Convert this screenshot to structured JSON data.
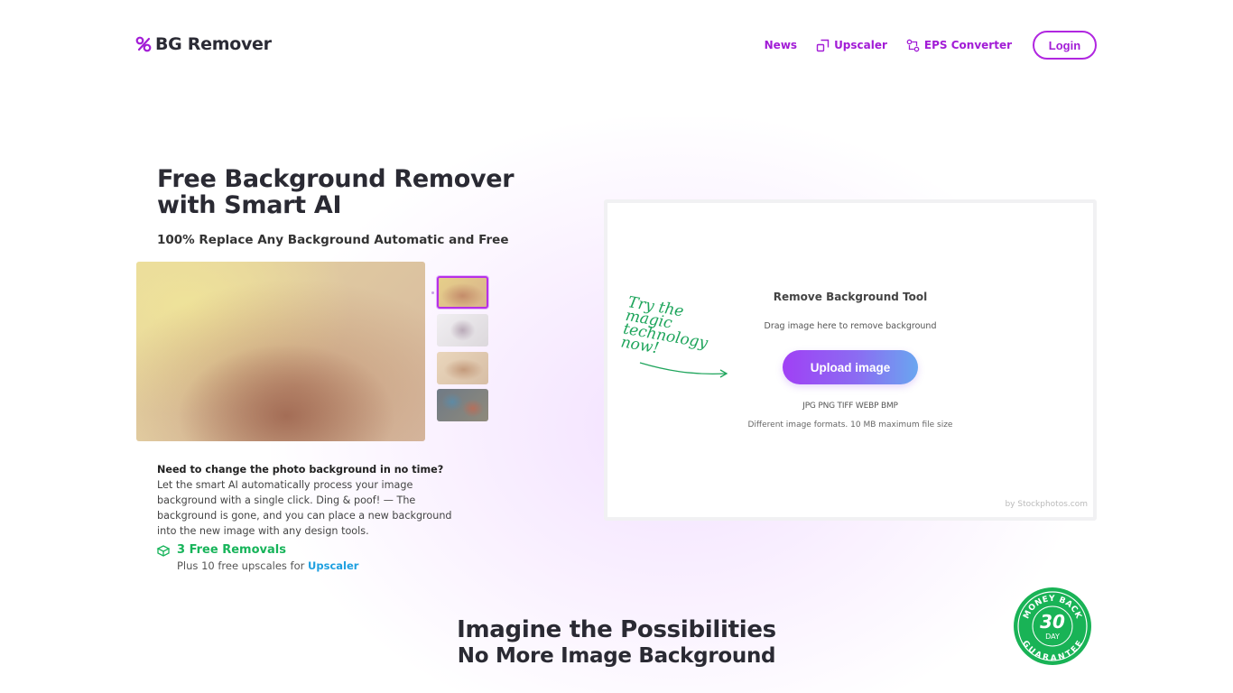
{
  "header": {
    "logo_text": "BG Remover",
    "nav": {
      "news": "News",
      "upscaler": "Upscaler",
      "eps_converter": "EPS Converter",
      "login": "Login"
    }
  },
  "hero": {
    "title_line1": "Free Background Remover",
    "title_line2": "with Smart AI",
    "subtitle": "100% Replace Any Background Automatic and Free",
    "description_bold": "Need to change the photo background in no time?",
    "description_rest": " Let the smart AI automatically process your image background with a single click. Ding & poof! — The background is gone, and you can place a new background into the new image with any design tools.",
    "free_removals": "3 Free Removals",
    "free_sub_prefix": "Plus 10 free upscales for ",
    "free_sub_link": "Upscaler"
  },
  "tool": {
    "handwritten": [
      "Try the",
      "magic",
      "technology",
      "now!"
    ],
    "title": "Remove Background Tool",
    "drag_hint": "Drag image here to remove background",
    "upload_label": "Upload image",
    "formats": "JPG PNG TIFF WEBP BMP",
    "limits": "Different image formats. 10 MB maximum file size",
    "credit": "by Stockphotos.com"
  },
  "bottom": {
    "heading_line1": "Imagine the Possibilities",
    "heading_line2": "No More Image Background"
  },
  "badge": {
    "top_text": "MONEY BACK",
    "number": "30",
    "unit": "DAY",
    "bottom_text": "GUARANTEE"
  },
  "colors": {
    "accent": "#a21cd6",
    "green": "#17b45a",
    "link_blue": "#1fa0e0"
  }
}
